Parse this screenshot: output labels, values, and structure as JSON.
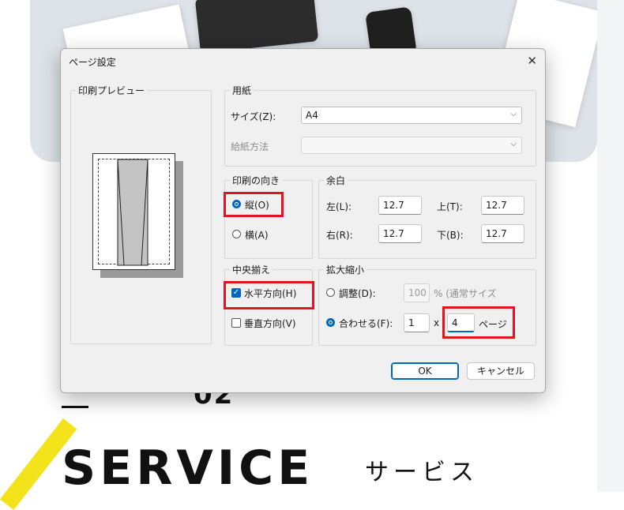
{
  "background": {
    "section_number": "02",
    "service_title": "SERVICE",
    "service_subtitle": "サービス"
  },
  "dialog": {
    "title": "ページ設定",
    "close_icon": "close-icon",
    "preview": {
      "legend": "印刷プレビュー"
    },
    "paper": {
      "legend": "用紙",
      "size_label": "サイズ(Z):",
      "size_value": "A4",
      "source_label": "給紙方法",
      "source_value": ""
    },
    "orientation": {
      "legend": "印刷の向き",
      "portrait": "縦(O)",
      "landscape": "横(A)",
      "selected": "portrait"
    },
    "margins": {
      "legend": "余白",
      "left_label": "左(L):",
      "left_value": "12.7",
      "top_label": "上(T):",
      "top_value": "12.7",
      "right_label": "右(R):",
      "right_value": "12.7",
      "bottom_label": "下(B):",
      "bottom_value": "12.7"
    },
    "centering": {
      "legend": "中央揃え",
      "horizontal": "水平方向(H)",
      "horizontal_checked": true,
      "vertical": "垂直方向(V)",
      "vertical_checked": false
    },
    "scaling": {
      "legend": "拡大縮小",
      "adjust_label": "調整(D):",
      "adjust_value": "100",
      "adjust_suffix": "% (通常サイズ",
      "fit_label": "合わせる(F):",
      "fit_width": "1",
      "times": "x",
      "fit_height": "4",
      "pages_label": "ページ",
      "selected": "fit"
    },
    "buttons": {
      "ok": "OK",
      "cancel": "キャンセル"
    },
    "highlight_color": "#e0151f",
    "accent_color": "#0067c0"
  }
}
